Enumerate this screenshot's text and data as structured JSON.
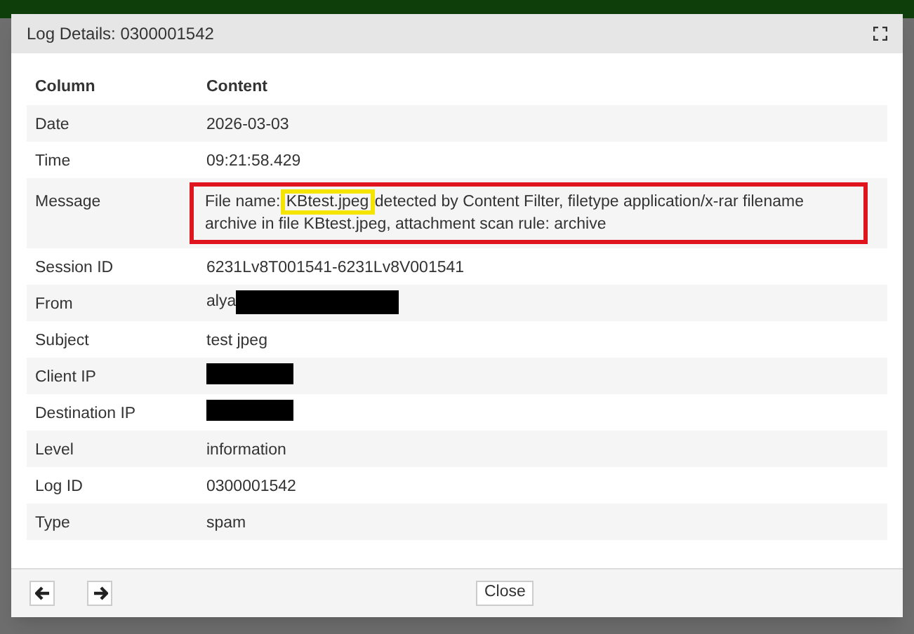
{
  "window": {
    "title": "Log Details: 0300001542"
  },
  "table": {
    "columns": [
      "Column",
      "Content"
    ],
    "rows": [
      {
        "kind": "text",
        "label": "Date",
        "value": "2026-03-03"
      },
      {
        "kind": "text",
        "label": "Time",
        "value": "09:21:58.429"
      },
      {
        "kind": "highlighted",
        "label": "Message",
        "value_prefix": "File name:",
        "value_highlight": "KBtest.jpeg",
        "value_rest": "detected by Content Filter, filetype application/x-rar filename archive in file KBtest.jpeg, attachment scan rule: archive"
      },
      {
        "kind": "text",
        "label": "Session ID",
        "value": "6231Lv8T001541-6231Lv8V001541"
      },
      {
        "kind": "redacted",
        "label": "From",
        "value": "alya"
      },
      {
        "kind": "text",
        "label": "Subject",
        "value": "test jpeg"
      },
      {
        "kind": "redacted",
        "label": "Client IP"
      },
      {
        "kind": "redacted",
        "label": "Destination IP"
      },
      {
        "kind": "text",
        "label": "Level",
        "value": "information"
      },
      {
        "kind": "text",
        "label": "Log ID",
        "value": "0300001542"
      },
      {
        "kind": "text",
        "label": "Type",
        "value": "spam"
      }
    ]
  },
  "footer": {
    "close_button": "Close"
  }
}
